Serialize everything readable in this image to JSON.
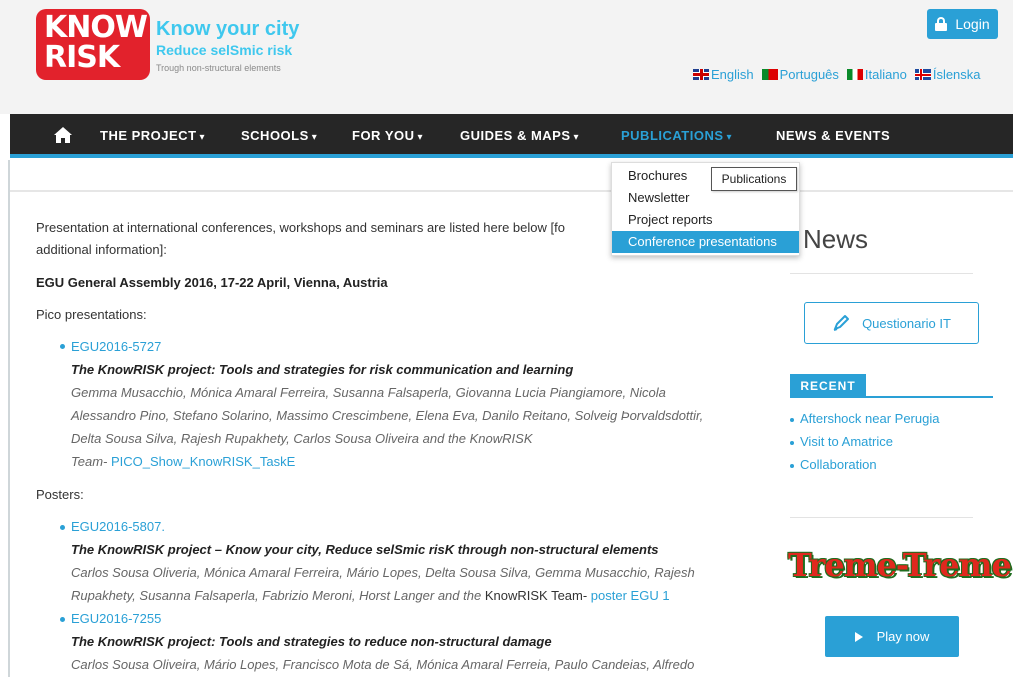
{
  "header": {
    "logo_line1": "KNOW",
    "logo_line2": "RISK",
    "tagline1": "Know your city",
    "tagline2": "Reduce selSmic risk",
    "tagline3": "Trough non-structural elements",
    "login_label": "Login",
    "languages": [
      {
        "label": "English",
        "flag": "uk-flag-icon"
      },
      {
        "label": "Português",
        "flag": "portugal-flag-icon"
      },
      {
        "label": "Italiano",
        "flag": "italy-flag-icon"
      },
      {
        "label": "Íslenska",
        "flag": "iceland-flag-icon"
      }
    ]
  },
  "nav": {
    "items": [
      {
        "label": "THE PROJECT",
        "caret": "▾"
      },
      {
        "label": "SCHOOLS",
        "caret": "▾"
      },
      {
        "label": "FOR YOU",
        "caret": "▾"
      },
      {
        "label": "GUIDES & MAPS",
        "caret": "▾"
      },
      {
        "label": "PUBLICATIONS",
        "caret": "▾",
        "active": true
      },
      {
        "label": "NEWS & EVENTS",
        "caret": ""
      }
    ],
    "dropdown": [
      "Brochures",
      "Newsletter",
      "Project reports",
      "Conference presentations"
    ],
    "tooltip": "Publications"
  },
  "main": {
    "intro_line1": "Presentation at  international conferences, workshops and seminars are listed here below [fo",
    "intro_line2": "additional information]:",
    "event_title": "EGU General Assembly 2016, 17-22 April, Vienna, Austria",
    "pico_heading": "Pico presentations:",
    "pico": {
      "link": "EGU2016-5727",
      "title": "The KnowRISK project: Tools and strategies for risk communication and learning",
      "authors_line1": "Gemma Musacchio, Mónica Amaral Ferreira, Susanna Falsaperla, Giovanna Lucia Piangiamore, Nicola",
      "authors_line2": "Alessandro Pino, Stefano Solarino, Massimo Crescimbene, Elena Eva, Danilo Reitano, Solveig Þorvaldsdottir,",
      "authors_line3": "Delta Sousa Silva, Rajesh Rupakhety, Carlos Sousa Oliveira and the KnowRISK",
      "team_prefix": "Team- ",
      "team_link": "PICO_Show_KnowRISK_TaskE"
    },
    "posters_heading": "Posters:",
    "poster1": {
      "link": "EGU2016-5807.",
      "title": "The KnowRISK project – Know your city, Reduce selSmic risK through non-structural elements",
      "authors_line1": "Carlos Sousa Oliveria, Mónica Amaral Ferreira, Mário Lopes, Delta Sousa Silva, Gemma Musacchio, Rajesh",
      "authors_line2_italic": "Rupakhety, Susanna Falsaperla, Fabrizio Meroni, Horst Langer and the ",
      "authors_line2_plain": "KnowRISK Team-  ",
      "poster_link": "poster EGU 1"
    },
    "poster2": {
      "link": "EGU2016-7255",
      "title": "The KnowRISK project: Tools and strategies to reduce non-structural damage",
      "authors_line1": "Carlos Sousa Oliveira, Mário Lopes, Francisco Mota de Sá, Mónica Amaral Ferreia, Paulo Candeias, Alfredo"
    }
  },
  "sidebar": {
    "news_title": "News",
    "questionario_label": "Questionario IT",
    "recent_label": "RECENT",
    "recent_items": [
      "Aftershock near Perugia",
      "Visit to Amatrice",
      "Collaboration"
    ],
    "game_logo": "Treme-Treme",
    "play_label": "Play now"
  },
  "colors": {
    "accent": "#2aa0d6",
    "brand_red": "#e2222c",
    "nav_bg": "#262626"
  }
}
